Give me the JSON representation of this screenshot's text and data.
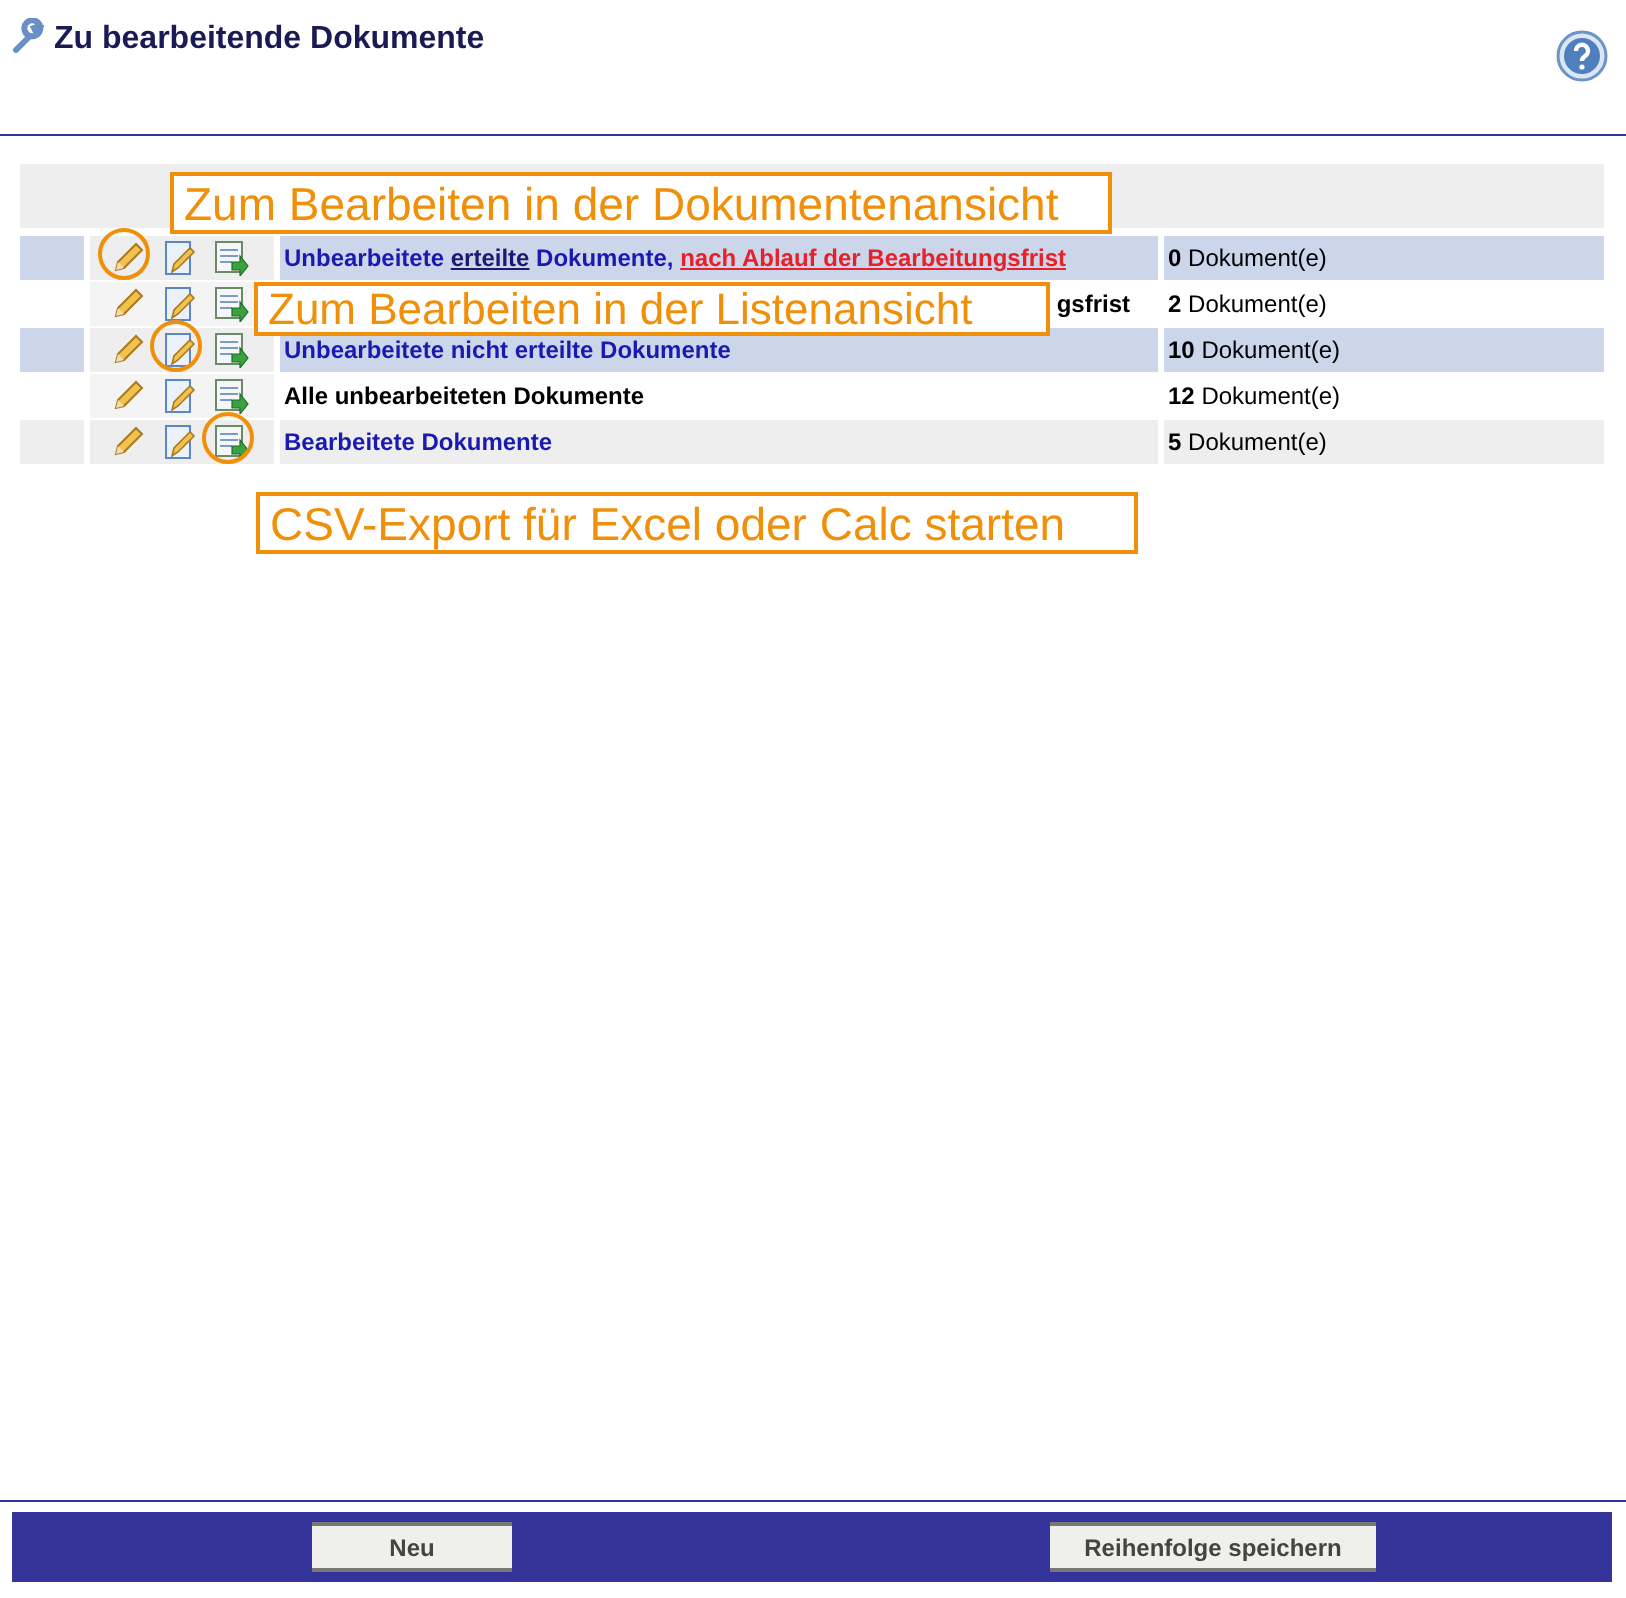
{
  "header": {
    "title": "Zu bearbeitende Dokumente"
  },
  "rows": [
    {
      "highlighted": true,
      "striped": false,
      "color": "#1a1ab0",
      "icons": [
        {
          "kind": "pencil",
          "circled": true
        },
        {
          "kind": "list-edit",
          "circled": false
        },
        {
          "kind": "export",
          "circled": false
        }
      ],
      "label": [
        {
          "kind": "text",
          "text": "Unbearbeitete "
        },
        {
          "kind": "link",
          "text": "erteilte"
        },
        {
          "kind": "text",
          "text": " Dokumente, "
        },
        {
          "kind": "alert-link",
          "text": "nach Ablauf der Bearbeitungsfrist"
        }
      ],
      "count": "**0** Dokument(e)"
    },
    {
      "highlighted": false,
      "striped": false,
      "color": "#000000",
      "icons": [
        {
          "kind": "pencil",
          "circled": false
        },
        {
          "kind": "list-edit",
          "circled": false
        },
        {
          "kind": "export",
          "circled": false
        }
      ],
      "label": [
        {
          "kind": "tail",
          "text": "gsfrist"
        }
      ],
      "count": "**2** Dokument(e)"
    },
    {
      "highlighted": true,
      "striped": false,
      "color": "#1a1ab0",
      "icons": [
        {
          "kind": "pencil",
          "circled": false
        },
        {
          "kind": "list-edit",
          "circled": true
        },
        {
          "kind": "export",
          "circled": false
        }
      ],
      "label": [
        {
          "kind": "text",
          "text": "Unbearbeitete nicht erteilte Dokumente"
        }
      ],
      "count": "**10** Dokument(e)"
    },
    {
      "highlighted": false,
      "striped": false,
      "color": "#000000",
      "icons": [
        {
          "kind": "pencil",
          "circled": false
        },
        {
          "kind": "list-edit",
          "circled": false
        },
        {
          "kind": "export",
          "circled": false
        }
      ],
      "label": [
        {
          "kind": "text",
          "text": "Alle unbearbeiteten Dokumente"
        }
      ],
      "count": "**12** Dokument(e)"
    },
    {
      "highlighted": false,
      "striped": true,
      "color": "#1a1ab0",
      "icons": [
        {
          "kind": "pencil",
          "circled": false
        },
        {
          "kind": "list-edit",
          "circled": false
        },
        {
          "kind": "export",
          "circled": true
        }
      ],
      "label": [
        {
          "kind": "text",
          "text": "Bearbeitete Dokumente"
        }
      ],
      "count": "**5** Dokument(e)"
    }
  ],
  "callouts": [
    {
      "text": "Zum Bearbeiten in der Dokumentenansicht"
    },
    {
      "text": "Zum Bearbeiten in der Listenansicht"
    },
    {
      "text": "CSV-Export für Excel oder Calc starten"
    }
  ],
  "footer": {
    "buttons": [
      "Neu",
      "Reihenfolge speichern"
    ]
  }
}
